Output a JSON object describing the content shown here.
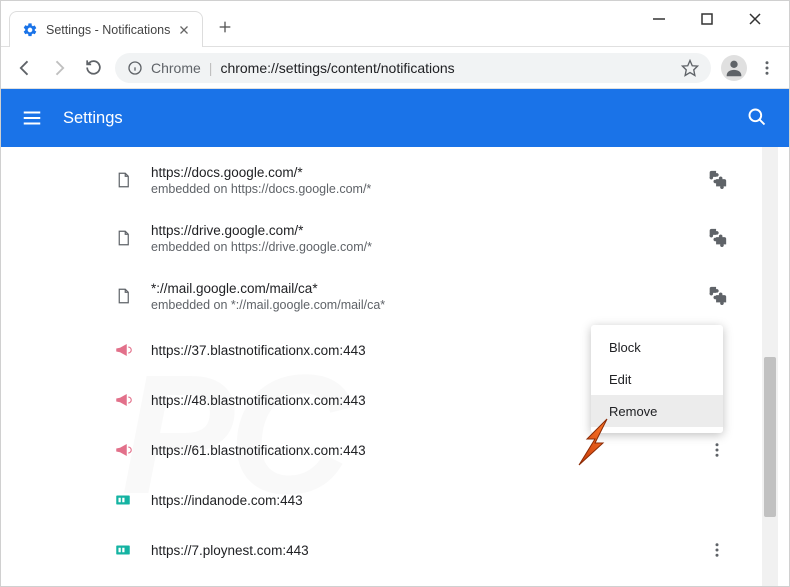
{
  "window": {
    "tab_title": "Settings - Notifications"
  },
  "omnibox": {
    "host": "Chrome",
    "path": "chrome://settings/content/notifications"
  },
  "header": {
    "title": "Settings"
  },
  "sites": [
    {
      "url": "https://docs.google.com/*",
      "sub": "embedded on https://docs.google.com/*",
      "icon": "doc",
      "action": "puzzle"
    },
    {
      "url": "https://drive.google.com/*",
      "sub": "embedded on https://drive.google.com/*",
      "icon": "doc",
      "action": "puzzle"
    },
    {
      "url": "*://mail.google.com/mail/ca*",
      "sub": "embedded on *://mail.google.com/mail/ca*",
      "icon": "doc",
      "action": "puzzle"
    },
    {
      "url": "https://37.blastnotificationx.com:443",
      "sub": "",
      "icon": "horn",
      "action": ""
    },
    {
      "url": "https://48.blastnotificationx.com:443",
      "sub": "",
      "icon": "horn",
      "action": ""
    },
    {
      "url": "https://61.blastnotificationx.com:443",
      "sub": "",
      "icon": "horn",
      "action": "dots"
    },
    {
      "url": "https://indanode.com:443",
      "sub": "",
      "icon": "teal",
      "action": ""
    },
    {
      "url": "https://7.ploynest.com:443",
      "sub": "",
      "icon": "teal",
      "action": "dots"
    }
  ],
  "context_menu": {
    "items": [
      "Block",
      "Edit",
      "Remove"
    ],
    "highlighted": 2
  }
}
